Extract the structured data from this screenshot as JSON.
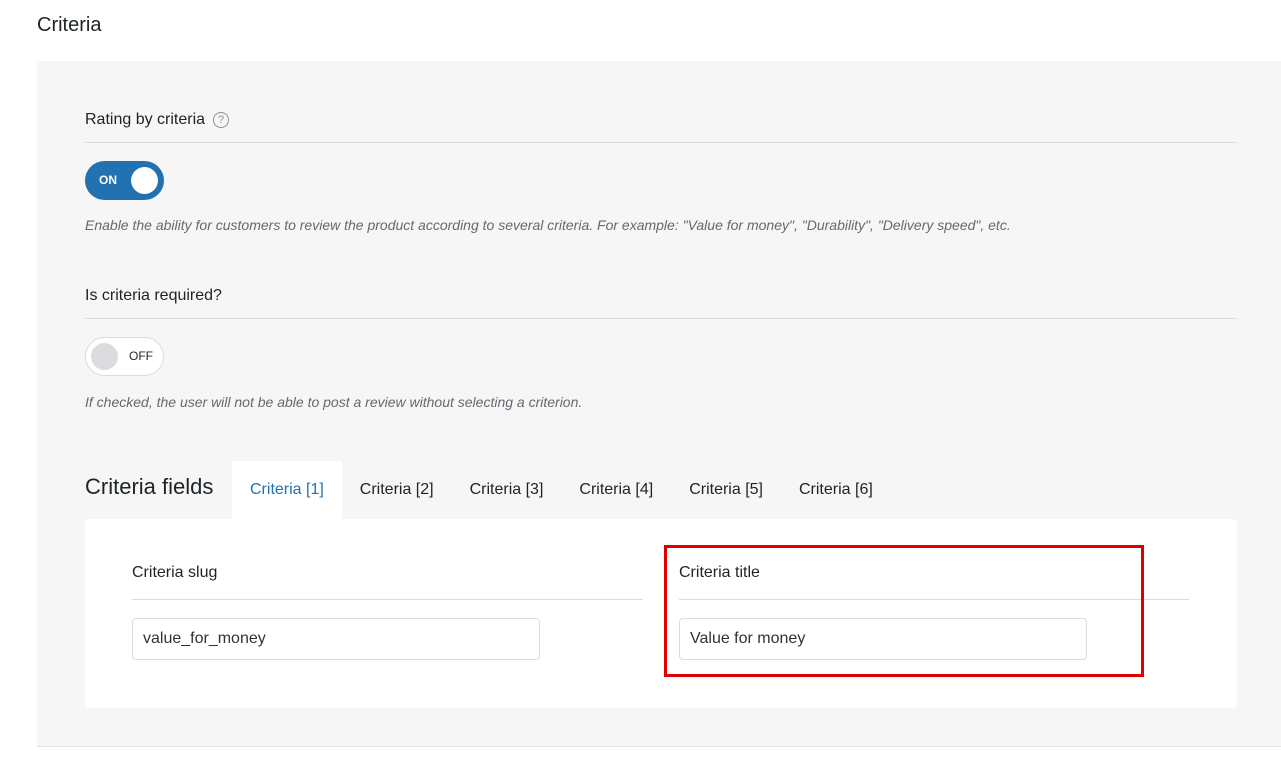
{
  "page": {
    "title": "Criteria"
  },
  "rating_by_criteria": {
    "label": "Rating by criteria",
    "help_glyph": "?",
    "toggle_state": "ON",
    "description": "Enable the ability for customers to review the product according to several criteria. For example: \"Value for money\", \"Durability\", \"Delivery speed\", etc."
  },
  "criteria_required": {
    "label": "Is criteria required?",
    "toggle_state": "OFF",
    "description": "If checked, the user will not be able to post a review without selecting a criterion."
  },
  "criteria_fields": {
    "heading": "Criteria fields",
    "tabs": [
      {
        "label": "Criteria [1]",
        "active": true
      },
      {
        "label": "Criteria [2]",
        "active": false
      },
      {
        "label": "Criteria [3]",
        "active": false
      },
      {
        "label": "Criteria [4]",
        "active": false
      },
      {
        "label": "Criteria [5]",
        "active": false
      },
      {
        "label": "Criteria [6]",
        "active": false
      }
    ],
    "slug": {
      "label": "Criteria slug",
      "value": "value_for_money"
    },
    "title": {
      "label": "Criteria title",
      "value": "Value for money"
    }
  },
  "colors": {
    "accent": "#2271b1",
    "highlight": "#e00000",
    "panel_bg": "#f6f6f6"
  }
}
